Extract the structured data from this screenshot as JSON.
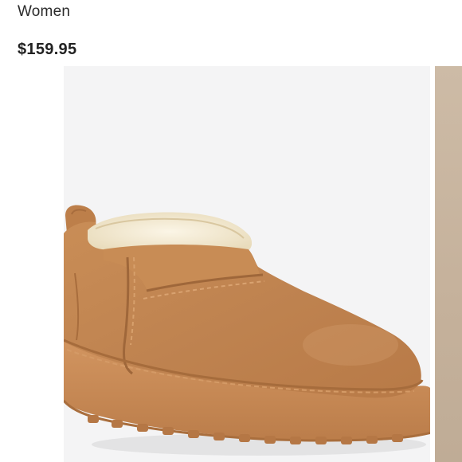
{
  "product": {
    "category": "Women",
    "price": "$159.95"
  },
  "gallery": {
    "main_image": "chestnut-suede-ultra-mini-boot",
    "next_image_peek": "tan-product-photo"
  },
  "colors": {
    "boot_suede": "#c2854f",
    "boot_sole": "#c88a55",
    "fleece": "#f4ead2",
    "image_background": "#f4f4f5",
    "text": "#222222"
  }
}
